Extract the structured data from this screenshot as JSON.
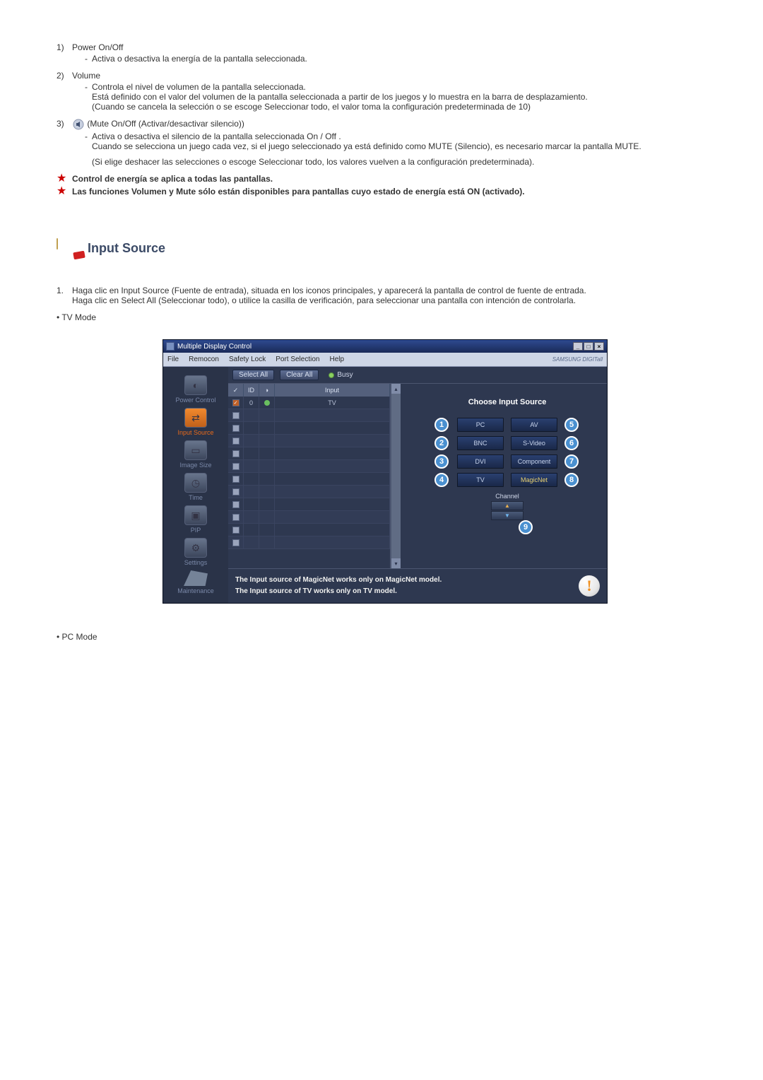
{
  "doc": {
    "items": [
      {
        "idx": "1)",
        "title": "Power On/Off",
        "lines": [
          "Activa o desactiva la energía de la pantalla seleccionada."
        ]
      },
      {
        "idx": "2)",
        "title": "Volume",
        "lines": [
          "Controla el nivel de volumen de la pantalla seleccionada.",
          "Está definido con el valor del volumen de la pantalla seleccionada a partir de los juegos y lo muestra en la barra de desplazamiento.",
          "(Cuando se cancela la selección o se escoge Seleccionar todo, el valor toma la configuración predeterminada de 10)"
        ]
      },
      {
        "idx": "3)",
        "title_after_icon": "(Mute On/Off (Activar/desactivar silencio))",
        "lines": [
          "Activa o desactiva el silencio de la pantalla seleccionada On / Off .",
          "Cuando se selecciona un juego cada vez, si el juego seleccionado ya está definido como MUTE (Silencio), es necesario marcar la pantalla MUTE.",
          "",
          "(Si elige deshacer las selecciones o escoge Seleccionar todo, los valores vuelven a la configuración predeterminada)."
        ]
      }
    ],
    "star1": "Control de energía se aplica a todas las pantallas.",
    "star2": "Las funciones Volumen y Mute sólo están disponibles para pantallas cuyo estado de energía está ON (activado).",
    "section_title": "Input Source",
    "plain1_idx": "1.",
    "plain1_a": "Haga clic en Input Source (Fuente de entrada), situada en los iconos principales, y aparecerá la pantalla de control de fuente de entrada.",
    "plain1_b": "Haga clic en Select All (Seleccionar todo), o utilice la casilla de verificación, para seleccionar una pantalla con intención de controlarla.",
    "tv_mode": "• TV Mode",
    "pc_mode": "• PC Mode"
  },
  "shot": {
    "title": "Multiple Display Control",
    "menu": {
      "file": "File",
      "remocon": "Remocon",
      "safety": "Safety Lock",
      "port": "Port Selection",
      "help": "Help",
      "logo": "SAMSUNG DIGITall"
    },
    "sidebar": {
      "power": "Power Control",
      "input": "Input Source",
      "image": "Image Size",
      "time": "Time",
      "pip": "PIP",
      "settings": "Settings",
      "maint": "Maintenance"
    },
    "toolbar": {
      "select_all": "Select All",
      "clear_all": "Clear All",
      "busy": "Busy"
    },
    "grid": {
      "h_chk": "✓",
      "h_id": "ID",
      "h_st": "",
      "h_input": "Input",
      "row0_id": "0",
      "row0_input": "TV"
    },
    "right": {
      "title": "Choose Input Source",
      "pc": "PC",
      "bnc": "BNC",
      "dvi": "DVI",
      "tv": "TV",
      "av": "AV",
      "svideo": "S-Video",
      "component": "Component",
      "magicnet": "MagicNet",
      "channel": "Channel"
    },
    "status": {
      "l1": "The Input source of MagicNet works only on MagicNet model.",
      "l2": "The Input source of TV works only on TV  model."
    },
    "nums": {
      "n1": "1",
      "n2": "2",
      "n3": "3",
      "n4": "4",
      "n5": "5",
      "n6": "6",
      "n7": "7",
      "n8": "8",
      "n9": "9"
    }
  }
}
